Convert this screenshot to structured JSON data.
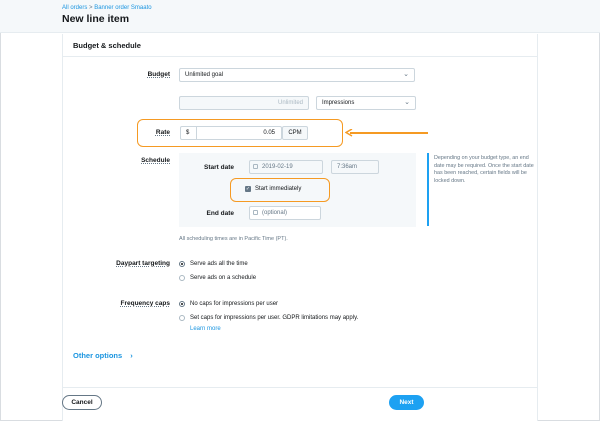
{
  "header": {
    "breadcrumb": [
      "All orders",
      ">",
      "Banner order Smaato"
    ],
    "title": "New line item"
  },
  "section": {
    "title": "Budget & schedule"
  },
  "budget": {
    "label": "Budget",
    "selected": "Unlimited goal",
    "amount_placeholder": "Unlimited",
    "unit_selected": "Impressions"
  },
  "rate": {
    "label": "Rate",
    "currency": "$",
    "value": "0.05",
    "unit": "CPM"
  },
  "schedule": {
    "label": "Schedule",
    "start_label": "Start date",
    "start_date": "2019-02-19",
    "start_time": "7:36am",
    "start_immediately": "Start immediately",
    "start_immediately_checked": true,
    "end_label": "End date",
    "end_placeholder": "(optional)",
    "timezone_note": "All scheduling times are in Pacific Time (PT).",
    "info": "Depending on your budget type, an end date may be required. Once the start date has been reached, certain fields will be locked down."
  },
  "daypart": {
    "label": "Daypart targeting",
    "options": [
      "Serve ads all the time",
      "Serve ads on a schedule"
    ],
    "selected_index": 0
  },
  "frequency": {
    "label": "Frequency caps",
    "options": [
      "No caps for impressions per user",
      "Set caps for impressions per user. GDPR limitations may apply."
    ],
    "learn_more": "Learn more",
    "selected_index": 0
  },
  "other_options": {
    "label": "Other options",
    "icon": "chevron-right-icon"
  },
  "footer": {
    "cancel_label": "Cancel",
    "next_label": "Next"
  },
  "colors": {
    "accent": "#1da1f2",
    "highlight": "#f59a23",
    "link": "#1b95e0"
  }
}
